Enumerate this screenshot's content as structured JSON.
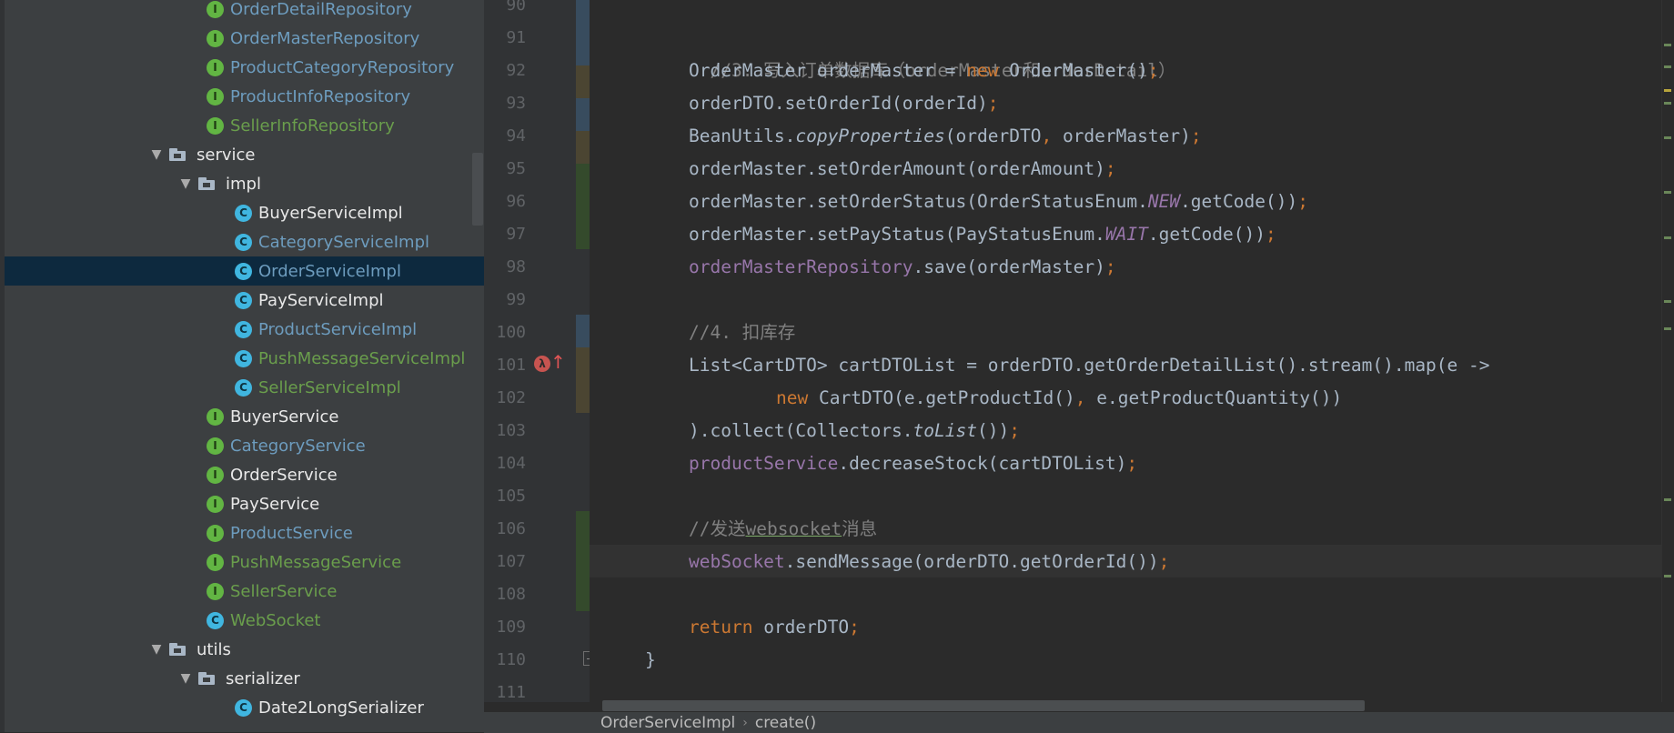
{
  "tree": {
    "items": [
      {
        "label": "OrderDetailRepository",
        "icon": "interface-icon",
        "kind": "interface",
        "color": "blue"
      },
      {
        "label": "OrderMasterRepository",
        "icon": "interface-icon",
        "kind": "interface",
        "color": "blue"
      },
      {
        "label": "ProductCategoryRepository",
        "icon": "interface-icon",
        "kind": "interface",
        "color": "blue"
      },
      {
        "label": "ProductInfoRepository",
        "icon": "interface-icon",
        "kind": "interface",
        "color": "blue"
      },
      {
        "label": "SellerInfoRepository",
        "icon": "interface-icon",
        "kind": "interface",
        "color": "green"
      },
      {
        "label": "service",
        "icon": "folder-icon",
        "kind": "folder",
        "expanded": true
      },
      {
        "label": "impl",
        "icon": "folder-icon",
        "kind": "folder",
        "expanded": true
      },
      {
        "label": "BuyerServiceImpl",
        "icon": "class-icon",
        "kind": "class",
        "color": "plain"
      },
      {
        "label": "CategoryServiceImpl",
        "icon": "class-icon",
        "kind": "class",
        "color": "blue"
      },
      {
        "label": "OrderServiceImpl",
        "icon": "class-icon",
        "kind": "class",
        "color": "blue",
        "selected": true
      },
      {
        "label": "PayServiceImpl",
        "icon": "class-icon",
        "kind": "class",
        "color": "plain"
      },
      {
        "label": "ProductServiceImpl",
        "icon": "class-icon",
        "kind": "class",
        "color": "blue"
      },
      {
        "label": "PushMessageServiceImpl",
        "icon": "class-icon",
        "kind": "class",
        "color": "green"
      },
      {
        "label": "SellerServiceImpl",
        "icon": "class-icon",
        "kind": "class",
        "color": "green"
      },
      {
        "label": "BuyerService",
        "icon": "interface-icon",
        "kind": "interface",
        "color": "plain"
      },
      {
        "label": "CategoryService",
        "icon": "interface-icon",
        "kind": "interface",
        "color": "blue"
      },
      {
        "label": "OrderService",
        "icon": "interface-icon",
        "kind": "interface",
        "color": "plain"
      },
      {
        "label": "PayService",
        "icon": "interface-icon",
        "kind": "interface",
        "color": "plain"
      },
      {
        "label": "ProductService",
        "icon": "interface-icon",
        "kind": "interface",
        "color": "blue"
      },
      {
        "label": "PushMessageService",
        "icon": "interface-icon",
        "kind": "interface",
        "color": "green"
      },
      {
        "label": "SellerService",
        "icon": "interface-icon",
        "kind": "interface",
        "color": "green"
      },
      {
        "label": "WebSocket",
        "icon": "class-icon",
        "kind": "class",
        "color": "green"
      },
      {
        "label": "utils",
        "icon": "folder-icon",
        "kind": "folder",
        "expanded": true
      },
      {
        "label": "serializer",
        "icon": "folder-icon",
        "kind": "folder",
        "expanded": true
      },
      {
        "label": "Date2LongSerializer",
        "icon": "class-icon",
        "kind": "class",
        "color": "plain"
      }
    ]
  },
  "editor": {
    "line_numbers": [
      "90",
      "91",
      "92",
      "93",
      "94",
      "95",
      "96",
      "97",
      "98",
      "99",
      "100",
      "101",
      "102",
      "103",
      "104",
      "105",
      "106",
      "107",
      "108",
      "109",
      "110",
      "111"
    ],
    "code": {
      "l91": "//3. 写入订单数据库（orderMaster和orderDetail）",
      "l92_a": "OrderMaster orderMaster = ",
      "l92_kw": "new",
      "l92_b": " OrderMaster()",
      "l92_semi": ";",
      "l93_a": "orderDTO.setOrderId(orderId)",
      "l93_semi": ";",
      "l94_a": "BeanUtils.",
      "l94_it": "copyProperties",
      "l94_b": "(orderDTO",
      "l94_comma": ",",
      "l94_c": " orderMaster)",
      "l94_semi": ";",
      "l95_a": "orderMaster.setOrderAmount(orderAmount)",
      "l95_semi": ";",
      "l96_a": "orderMaster.setOrderStatus(OrderStatusEnum.",
      "l96_const": "NEW",
      "l96_b": ".getCode())",
      "l96_semi": ";",
      "l97_a": "orderMaster.setPayStatus(PayStatusEnum.",
      "l97_const": "WAIT",
      "l97_b": ".getCode())",
      "l97_semi": ";",
      "l98_fld": "orderMasterRepository",
      "l98_a": ".save(orderMaster)",
      "l98_semi": ";",
      "l100": "//4. 扣库存",
      "l101": "List<CartDTO> cartDTOList = orderDTO.getOrderDetailList().stream().map(e ->",
      "l102_kw": "new",
      "l102_a": " CartDTO(e.getProductId()",
      "l102_comma": ",",
      "l102_b": " e.getProductQuantity())",
      "l103_a": ").collect(Collectors.",
      "l103_it": "toList",
      "l103_b": "())",
      "l103_semi": ";",
      "l104_fld": "productService",
      "l104_a": ".decreaseStock(cartDTOList)",
      "l104_semi": ";",
      "l106_a": "//发送",
      "l106_ws": "websocket",
      "l106_b": "消息",
      "l107_fld": "webSocket",
      "l107_a": ".sendMessage(orderDTO.getOrderId())",
      "l107_semi": ";",
      "l109_kw": "return",
      "l109_a": " orderDTO",
      "l109_semi": ";",
      "l110": "}"
    },
    "gutter_icons": [
      "lambda-icon",
      "override-arrow-icon",
      "fold-icon"
    ]
  },
  "breadcrumb": {
    "class_name": "OrderServiceImpl",
    "separator": "›",
    "method": "create()"
  },
  "colors": {
    "background": "#2b2b2b",
    "tree_background": "#3c3f41",
    "selection": "#0d293e",
    "keyword": "#cc7832",
    "comment": "#808080",
    "field": "#9876aa",
    "text": "#a9b7c6",
    "vcs_modified": "#384c5e",
    "vcs_added": "#344a2c"
  }
}
